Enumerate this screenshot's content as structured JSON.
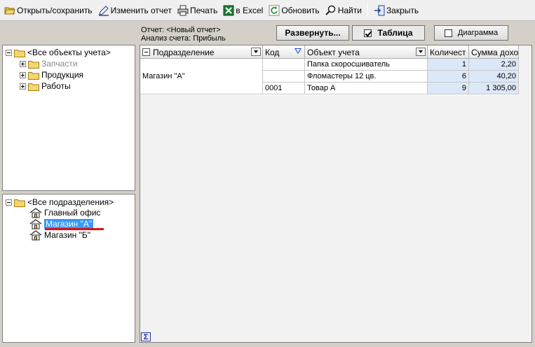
{
  "toolbar": {
    "open_save": "Открыть/сохранить",
    "edit_report": "Изменить отчет",
    "print": "Печать",
    "excel": "в Excel",
    "refresh": "Обновить",
    "find": "Найти",
    "close": "Закрыть"
  },
  "report_info": {
    "report_line": "Отчет:  <Новый отчет>",
    "account_line": "Анализ счета:  Прибыль"
  },
  "view_buttons": {
    "expand": "Развернуть...",
    "table": "Таблица",
    "chart": "Диаграмма",
    "table_checked": true,
    "chart_checked": false
  },
  "objects_tree": {
    "root": "<Все объекты учета>",
    "items": [
      "Запчасти",
      "Продукция",
      "Работы"
    ]
  },
  "divisions_tree": {
    "root": "<Все подразделения>",
    "items": [
      "Главный офис",
      "Магазин \"А\"",
      "Магазин \"Б\""
    ],
    "selected_index": 1
  },
  "grid": {
    "columns": [
      "Подразделение",
      "Код",
      "Объект учета",
      "Количест",
      "Сумма дохо"
    ],
    "group_label": "Магазин \"А\"",
    "rows": [
      {
        "code": "",
        "object": "Папка скоросшиватель",
        "qty": "1",
        "sum": "2,20"
      },
      {
        "code": "",
        "object": "Фломастеры 12 цв.",
        "qty": "6",
        "sum": "40,20"
      },
      {
        "code": "0001",
        "object": "Товар А",
        "qty": "9",
        "sum": "1 305,00"
      }
    ],
    "footer_symbol": "Σ"
  },
  "colors": {
    "selection": "#3399ff",
    "highlight_line": "#e01010",
    "numeric_cell": "#dbe8f8"
  }
}
